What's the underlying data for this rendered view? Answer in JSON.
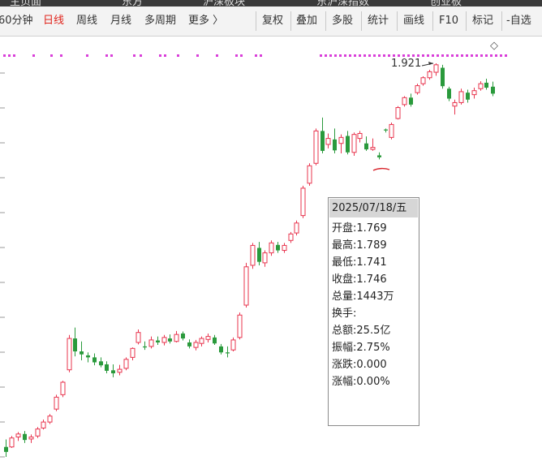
{
  "top_tabs": [
    "主页面",
    "东方",
    "沪深板块",
    "东沪深指数",
    "创业板"
  ],
  "toolbar": {
    "period_items": [
      "60分钟",
      "日线",
      "周线",
      "月线",
      "多周期",
      "更多 〉"
    ],
    "active_period": "日线",
    "tool_buttons": [
      "复权",
      "叠加",
      "多股",
      "统计",
      "画线",
      "F10",
      "标记"
    ],
    "self_select": "-自选"
  },
  "chart": {
    "peak_label": "1.921",
    "diamond_icon": "◇",
    "colors": {
      "up": "#e8344e",
      "down": "#2a9a3c",
      "marker": "#d93fd9",
      "annotation": "#d8242c"
    }
  },
  "tooltip": {
    "date": "2025/07/18/五",
    "rows": [
      {
        "label": "开盘",
        "value": "1.769"
      },
      {
        "label": "最高",
        "value": "1.789"
      },
      {
        "label": "最低",
        "value": "1.741"
      },
      {
        "label": "收盘",
        "value": "1.746"
      },
      {
        "label": "总量",
        "value": "1443万"
      },
      {
        "label": "换手",
        "value": ""
      },
      {
        "label": "总额",
        "value": "25.5亿"
      },
      {
        "label": "振幅",
        "value": "2.75%"
      },
      {
        "label": "涨跌",
        "value": "0.000"
      },
      {
        "label": "涨幅",
        "value": "0.00%"
      }
    ]
  },
  "chart_data": {
    "type": "candlestick",
    "ohlc": [
      [
        1.15,
        1.165,
        1.13,
        1.14
      ],
      [
        1.15,
        1.172,
        1.148,
        1.168
      ],
      [
        1.17,
        1.18,
        1.162,
        1.176
      ],
      [
        1.176,
        1.182,
        1.158,
        1.164
      ],
      [
        1.166,
        1.175,
        1.158,
        1.17
      ],
      [
        1.172,
        1.19,
        1.168,
        1.186
      ],
      [
        1.188,
        1.205,
        1.185,
        1.2
      ],
      [
        1.2,
        1.216,
        1.196,
        1.212
      ],
      [
        1.226,
        1.255,
        1.222,
        1.25
      ],
      [
        1.255,
        1.283,
        1.25,
        1.28
      ],
      [
        1.305,
        1.375,
        1.3,
        1.368
      ],
      [
        1.368,
        1.39,
        1.332,
        1.342
      ],
      [
        1.342,
        1.362,
        1.324,
        1.336
      ],
      [
        1.334,
        1.34,
        1.32,
        1.33
      ],
      [
        1.33,
        1.338,
        1.314,
        1.32
      ],
      [
        1.322,
        1.33,
        1.31,
        1.314
      ],
      [
        1.316,
        1.322,
        1.298,
        1.303
      ],
      [
        1.304,
        1.316,
        1.29,
        1.298
      ],
      [
        1.3,
        1.315,
        1.294,
        1.306
      ],
      [
        1.308,
        1.33,
        1.304,
        1.326
      ],
      [
        1.33,
        1.35,
        1.324,
        1.348
      ],
      [
        1.36,
        1.386,
        1.356,
        1.38
      ],
      [
        1.352,
        1.362,
        1.345,
        1.35
      ],
      [
        1.352,
        1.372,
        1.348,
        1.365
      ],
      [
        1.364,
        1.372,
        1.355,
        1.36
      ],
      [
        1.36,
        1.375,
        1.354,
        1.37
      ],
      [
        1.368,
        1.376,
        1.358,
        1.362
      ],
      [
        1.362,
        1.383,
        1.36,
        1.376
      ],
      [
        1.378,
        1.382,
        1.364,
        1.368
      ],
      [
        1.36,
        1.366,
        1.348,
        1.352
      ],
      [
        1.35,
        1.365,
        1.344,
        1.36
      ],
      [
        1.358,
        1.372,
        1.352,
        1.368
      ],
      [
        1.366,
        1.378,
        1.36,
        1.372
      ],
      [
        1.37,
        1.375,
        1.355,
        1.358
      ],
      [
        1.352,
        1.357,
        1.336,
        1.34
      ],
      [
        1.34,
        1.352,
        1.33,
        1.338
      ],
      [
        1.345,
        1.37,
        1.342,
        1.365
      ],
      [
        1.37,
        1.42,
        1.366,
        1.415
      ],
      [
        1.435,
        1.52,
        1.43,
        1.512
      ],
      [
        1.515,
        1.56,
        1.508,
        1.555
      ],
      [
        1.55,
        1.562,
        1.515,
        1.522
      ],
      [
        1.52,
        1.545,
        1.512,
        1.54
      ],
      [
        1.54,
        1.565,
        1.534,
        1.56
      ],
      [
        1.556,
        1.562,
        1.54,
        1.545
      ],
      [
        1.545,
        1.56,
        1.54,
        1.555
      ],
      [
        1.565,
        1.582,
        1.56,
        1.578
      ],
      [
        1.58,
        1.605,
        1.575,
        1.6
      ],
      [
        1.615,
        1.675,
        1.61,
        1.67
      ],
      [
        1.68,
        1.72,
        1.675,
        1.715
      ],
      [
        1.72,
        1.79,
        1.716,
        1.785
      ],
      [
        1.785,
        1.812,
        1.74,
        1.745
      ],
      [
        1.758,
        1.78,
        1.75,
        1.77
      ],
      [
        1.768,
        1.79,
        1.74,
        1.746
      ],
      [
        1.76,
        1.778,
        1.74,
        1.772
      ],
      [
        1.775,
        1.785,
        1.738,
        1.742
      ],
      [
        1.742,
        1.782,
        1.735,
        1.778
      ],
      [
        1.77,
        1.785,
        1.762,
        1.78
      ],
      [
        1.76,
        1.774,
        1.745,
        1.748
      ],
      [
        1.748,
        1.77,
        1.745,
        1.752
      ],
      [
        1.736,
        1.742,
        1.728,
        1.732
      ],
      [
        1.788,
        1.79,
        1.782,
        1.786
      ],
      [
        1.772,
        1.802,
        1.768,
        1.798
      ],
      [
        1.81,
        1.835,
        1.808,
        1.832
      ],
      [
        1.838,
        1.855,
        1.834,
        1.852
      ],
      [
        1.852,
        1.86,
        1.834,
        1.838
      ],
      [
        1.862,
        1.88,
        1.858,
        1.876
      ],
      [
        1.88,
        1.895,
        1.876,
        1.892
      ],
      [
        1.892,
        1.908,
        1.888,
        1.904
      ],
      [
        1.903,
        1.921,
        1.896,
        1.918
      ],
      [
        1.912,
        1.918,
        1.87,
        1.875
      ],
      [
        1.87,
        1.874,
        1.845,
        1.85
      ],
      [
        1.835,
        1.848,
        1.818,
        1.842
      ],
      [
        1.842,
        1.87,
        1.838,
        1.864
      ],
      [
        1.862,
        1.868,
        1.842,
        1.848
      ],
      [
        1.858,
        1.872,
        1.85,
        1.866
      ],
      [
        1.87,
        1.885,
        1.866,
        1.88
      ],
      [
        1.882,
        1.89,
        1.868,
        1.872
      ],
      [
        1.874,
        1.884,
        1.855,
        1.86
      ]
    ],
    "peak_value": 1.921,
    "marker_rows": "magenta dotted marker row above price series",
    "grid": "left-edge tick marks only"
  }
}
